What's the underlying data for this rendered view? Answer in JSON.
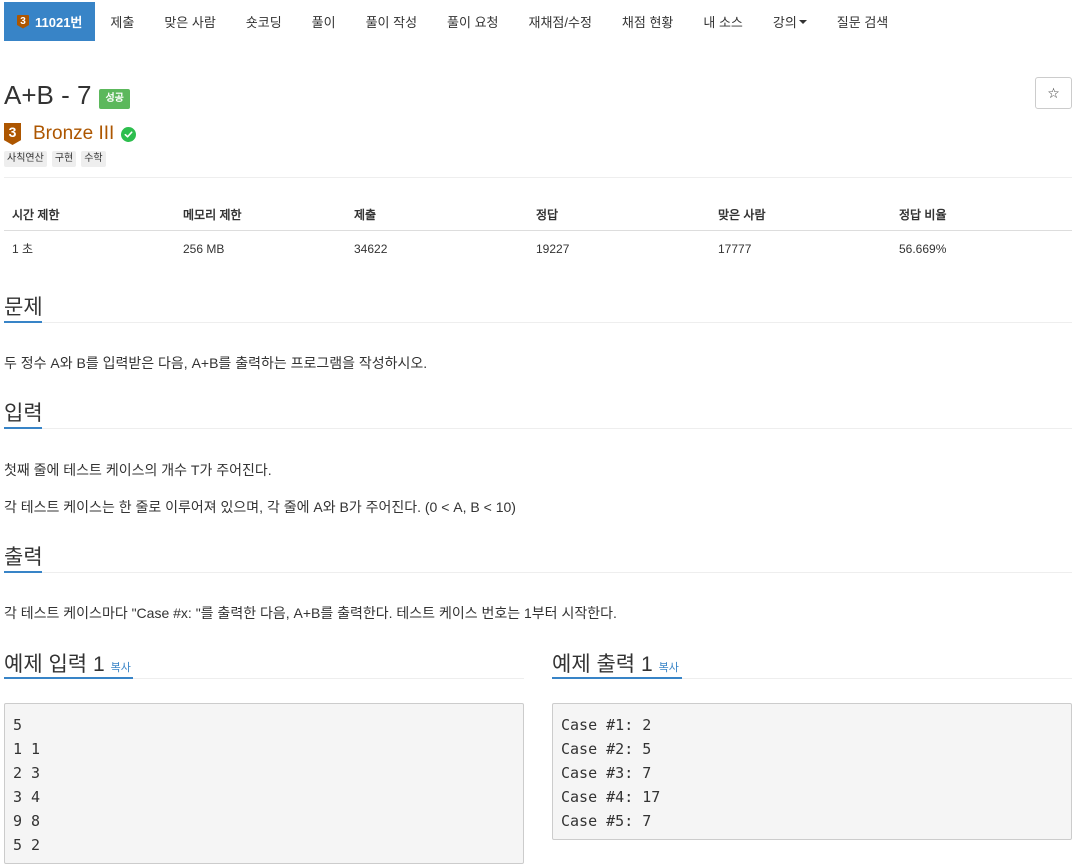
{
  "nav": {
    "problem_number": "11021번",
    "tier_number": "3",
    "items": [
      "제출",
      "맞은 사람",
      "숏코딩",
      "풀이",
      "풀이 작성",
      "풀이 요청",
      "재채점/수정",
      "채점 현황",
      "내 소스",
      "강의",
      "질문 검색"
    ]
  },
  "problem": {
    "title": "A+B - 7",
    "result_label": "성공",
    "tier": "Bronze III",
    "tier_number": "3",
    "tags": [
      "사칙연산",
      "구현",
      "수학"
    ],
    "star": "☆"
  },
  "info": {
    "headers": [
      "시간 제한",
      "메모리 제한",
      "제출",
      "정답",
      "맞은 사람",
      "정답 비율"
    ],
    "values": [
      "1 초",
      "256 MB",
      "34622",
      "19227",
      "17777",
      "56.669%"
    ]
  },
  "sections": {
    "problem_title": "문제",
    "problem_text": "두 정수 A와 B를 입력받은 다음, A+B를 출력하는 프로그램을 작성하시오.",
    "input_title": "입력",
    "input_text_1": "첫째 줄에 테스트 케이스의 개수 T가 주어진다.",
    "input_text_2": "각 테스트 케이스는 한 줄로 이루어져 있으며, 각 줄에 A와 B가 주어진다. (0 < A, B < 10)",
    "output_title": "출력",
    "output_text": "각 테스트 케이스마다 \"Case #x: \"를 출력한 다음, A+B를 출력한다. 테스트 케이스 번호는 1부터 시작한다.",
    "sample_input_title": "예제 입력 1",
    "sample_output_title": "예제 출력 1",
    "copy_label": "복사",
    "sample_input": "5\n1 1\n2 3\n3 4\n9 8\n5 2",
    "sample_output": "Case #1: 2\nCase #2: 5\nCase #3: 7\nCase #4: 17\nCase #5: 7"
  },
  "colors": {
    "primary": "#3884c7",
    "bronze": "#ad5600",
    "success": "#5cb85c",
    "check": "#2dbe4e"
  }
}
